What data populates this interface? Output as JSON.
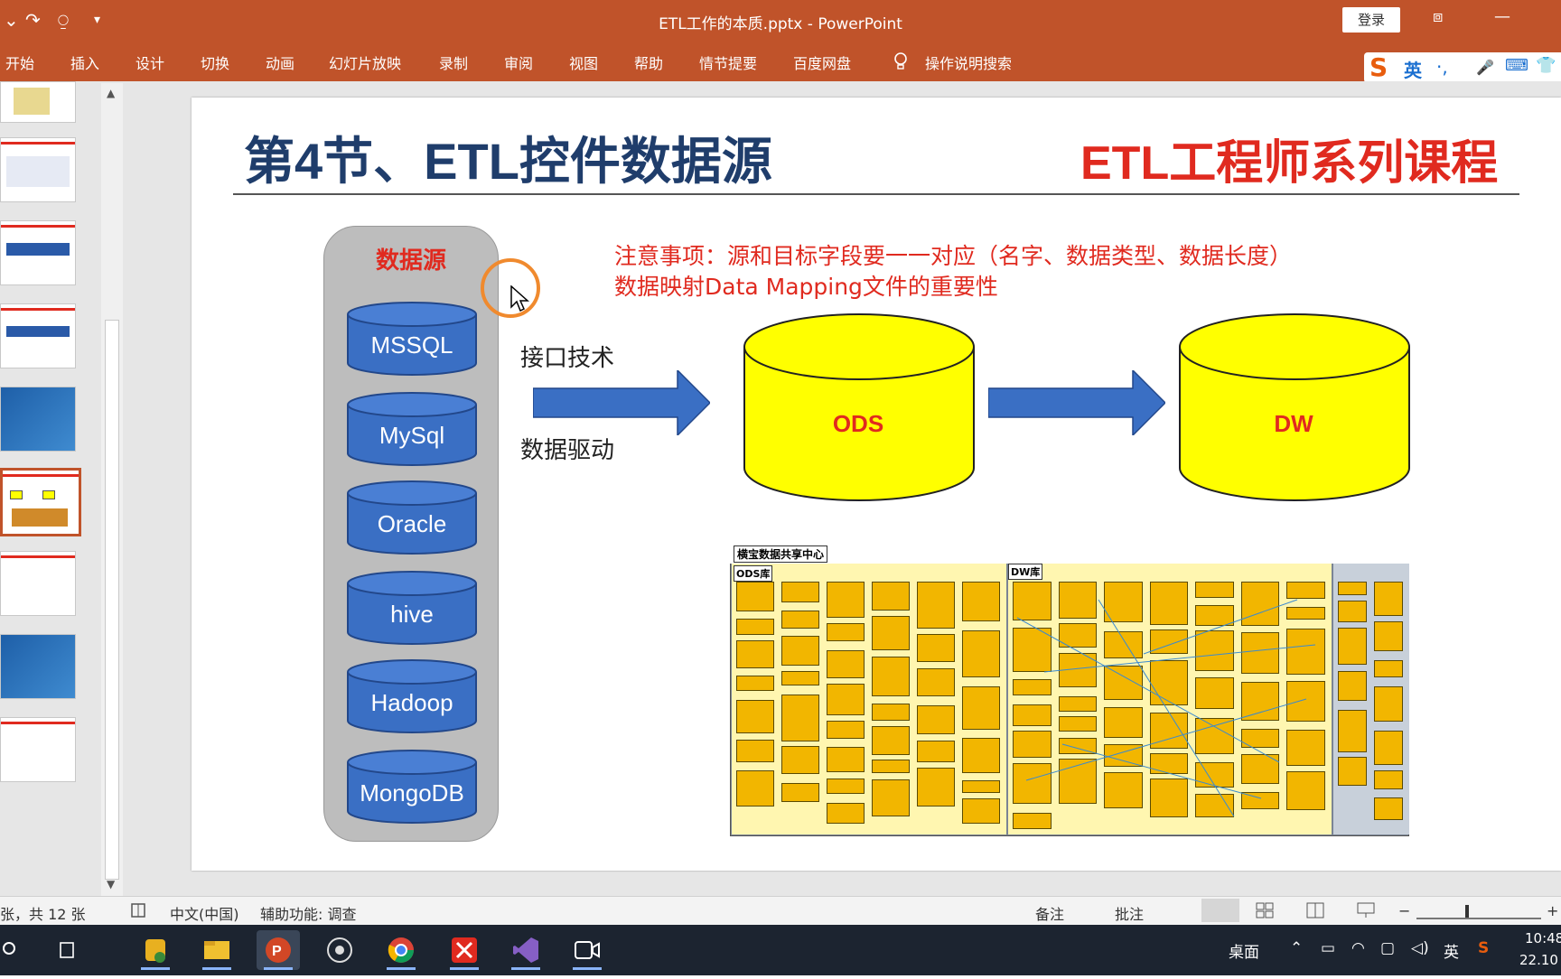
{
  "window": {
    "title": "ETL工作的本质.pptx  -  PowerPoint",
    "login_label": "登录",
    "controls": [
      "⧈",
      "—"
    ]
  },
  "quick_access": [
    "⌄",
    "↷",
    "⍜",
    "▾"
  ],
  "ribbon": {
    "tabs": [
      "开始",
      "插入",
      "设计",
      "切换",
      "动画",
      "幻灯片放映",
      "录制",
      "审阅",
      "视图",
      "帮助",
      "情节提要",
      "百度网盘"
    ],
    "search_label": "操作说明搜索",
    "ime": [
      "S",
      "英",
      "·,",
      "🎤",
      "⌨",
      "👕"
    ]
  },
  "slide": {
    "title": "第4节、ETL控件数据源",
    "series": "ETL工程师系列课程",
    "datasource_label": "数据源",
    "datasources": [
      "MSSQL",
      "MySql",
      "Oracle",
      "hive",
      "Hadoop",
      "MongoDB"
    ],
    "notice_line1": "注意事项：源和目标字段要一一对应（名字、数据类型、数据长度）",
    "notice_line2": "数据映射Data Mapping文件的重要性",
    "interface_label": "接口技术",
    "driver_label": "数据驱动",
    "ods_label": "ODS",
    "dw_label": "DW",
    "diagram_title": "横宝数据共享中心",
    "diagram_ods_zone": "ODS库",
    "diagram_dw_zone": "DW库",
    "colors": {
      "title": "#1f3d6b",
      "accent_red": "#e02a1f",
      "cylinder_blue": "#3a6fc4",
      "cylinder_yellow": "#ffff00",
      "arrow_blue": "#3a6fc4"
    }
  },
  "statusbar": {
    "slide_count": "张，共 12 张",
    "language": "中文(中国)",
    "accessibility": "辅助功能: 调查",
    "notes": "备注",
    "comments": "批注"
  },
  "taskbar": {
    "desktop_label": "桌面",
    "lang": "英",
    "time": "10:48",
    "date": "22.10"
  }
}
